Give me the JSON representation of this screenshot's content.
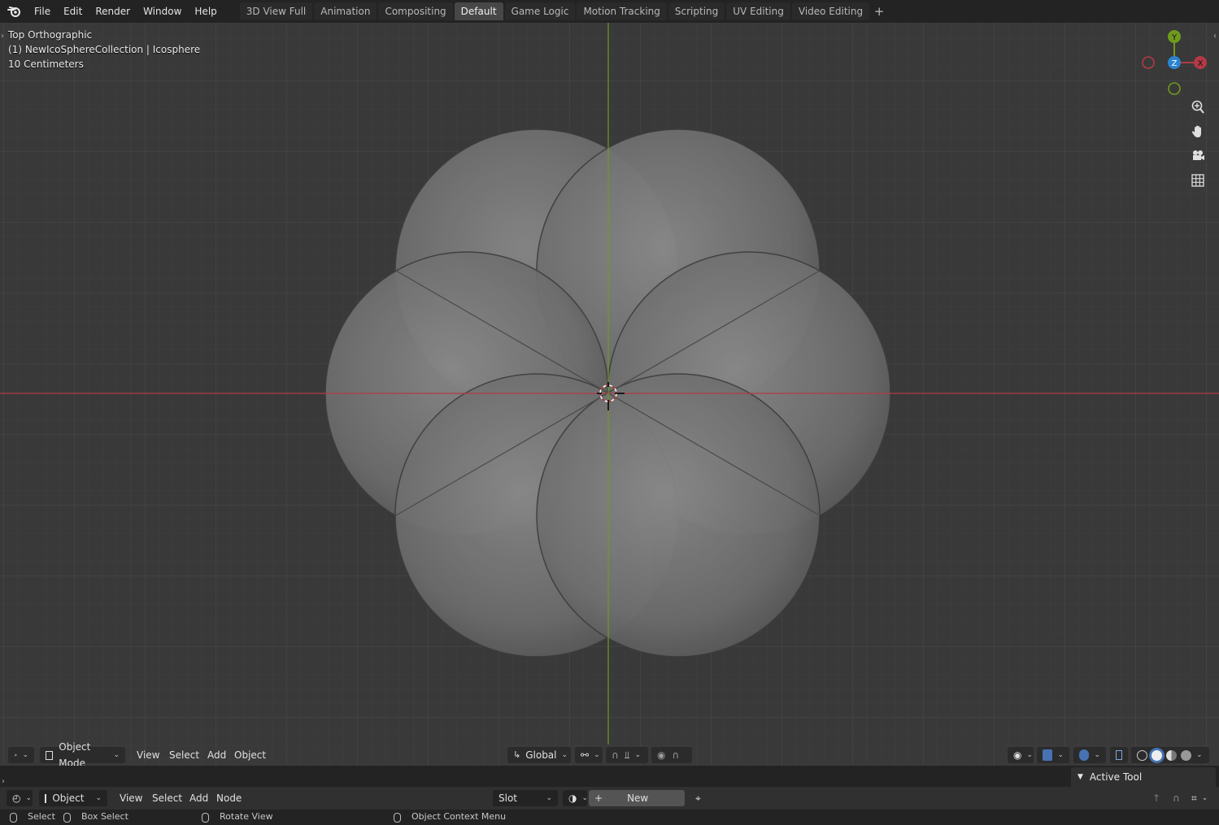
{
  "app": {
    "menu": [
      "File",
      "Edit",
      "Render",
      "Window",
      "Help"
    ],
    "workspaces": [
      "3D View Full",
      "Animation",
      "Compositing",
      "Default",
      "Game Logic",
      "Motion Tracking",
      "Scripting",
      "UV Editing",
      "Video Editing"
    ],
    "active_workspace": "Default"
  },
  "viewport": {
    "view_name": "Top Orthographic",
    "collection_info": "(1) NewIcoSphereCollection | Icosphere",
    "grid_scale": "10 Centimeters",
    "gizmo": {
      "y": "Y",
      "x": "X",
      "z": "Z"
    },
    "colors": {
      "x_axis": "#b23a46",
      "y_axis": "#6f9a1d",
      "z_axis": "#2a84d2",
      "background": "#393939"
    }
  },
  "viewport_header": {
    "mode": "Object Mode",
    "menus": [
      "View",
      "Select",
      "Add",
      "Object"
    ],
    "transform_orientation": "Global"
  },
  "node_header": {
    "context": "Object",
    "menus": [
      "View",
      "Select",
      "Add",
      "Node"
    ],
    "slot": "Slot",
    "new_button": "New"
  },
  "active_tool_panel": {
    "title": "Active Tool"
  },
  "statusbar": {
    "select": "Select",
    "box_select": "Box Select",
    "rotate_view": "Rotate View",
    "context_menu": "Object Context Menu"
  }
}
